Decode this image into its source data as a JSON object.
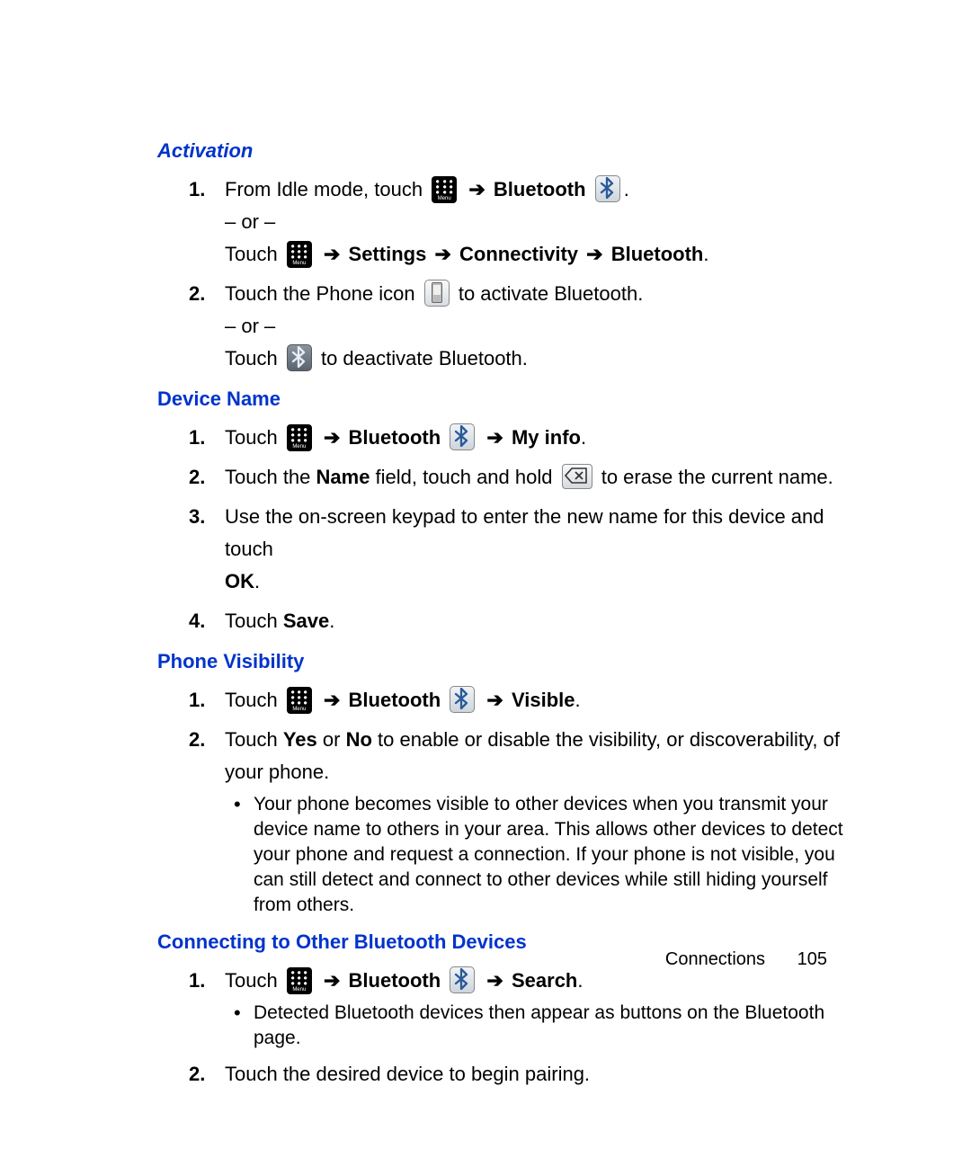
{
  "headings": {
    "activation": "Activation",
    "device_name": "Device Name",
    "phone_visibility": "Phone Visibility",
    "connecting": "Connecting to Other Bluetooth Devices"
  },
  "labels": {
    "bluetooth": "Bluetooth",
    "settings": "Settings",
    "connectivity": "Connectivity",
    "my_info": "My info",
    "visible": "Visible",
    "search": "Search",
    "ok": "OK",
    "save": "Save",
    "name_field": "Name",
    "yes": "Yes",
    "no": "No"
  },
  "text": {
    "from_idle_touch": "From Idle mode, touch ",
    "or": "– or –",
    "touch": "Touch ",
    "touch_phone_icon_pre": "Touch the Phone icon ",
    "touch_phone_icon_post": " to activate Bluetooth.",
    "deactivate_post": " to deactivate Bluetooth.",
    "touch_the": "Touch the ",
    "name_field_post": " field, touch and hold ",
    "erase_post": " to erase the current name.",
    "use_keypad": "Use the on-screen keypad to enter the new name for this device and touch ",
    "touch_save_pre": "Touch ",
    "visibility_sentence_pre": "Touch ",
    "visibility_sentence_mid": " or ",
    "visibility_sentence_post": " to enable or disable the visibility, or discoverability, of your phone.",
    "visibility_detail": "Your phone becomes visible to other devices when you transmit your device name to others in your area. This allows other devices to detect your phone and request a connection. If your phone is not visible, you can still detect and connect to other devices while still hiding yourself from others.",
    "detected_bt": "Detected Bluetooth devices then appear as buttons on the Bluetooth page.",
    "touch_desired": "Touch the desired device to begin pairing.",
    "arrow": "➔",
    "period": "."
  },
  "nums": {
    "n1": "1.",
    "n2": "2.",
    "n3": "3.",
    "n4": "4."
  },
  "footer": {
    "section": "Connections",
    "page": "105"
  }
}
